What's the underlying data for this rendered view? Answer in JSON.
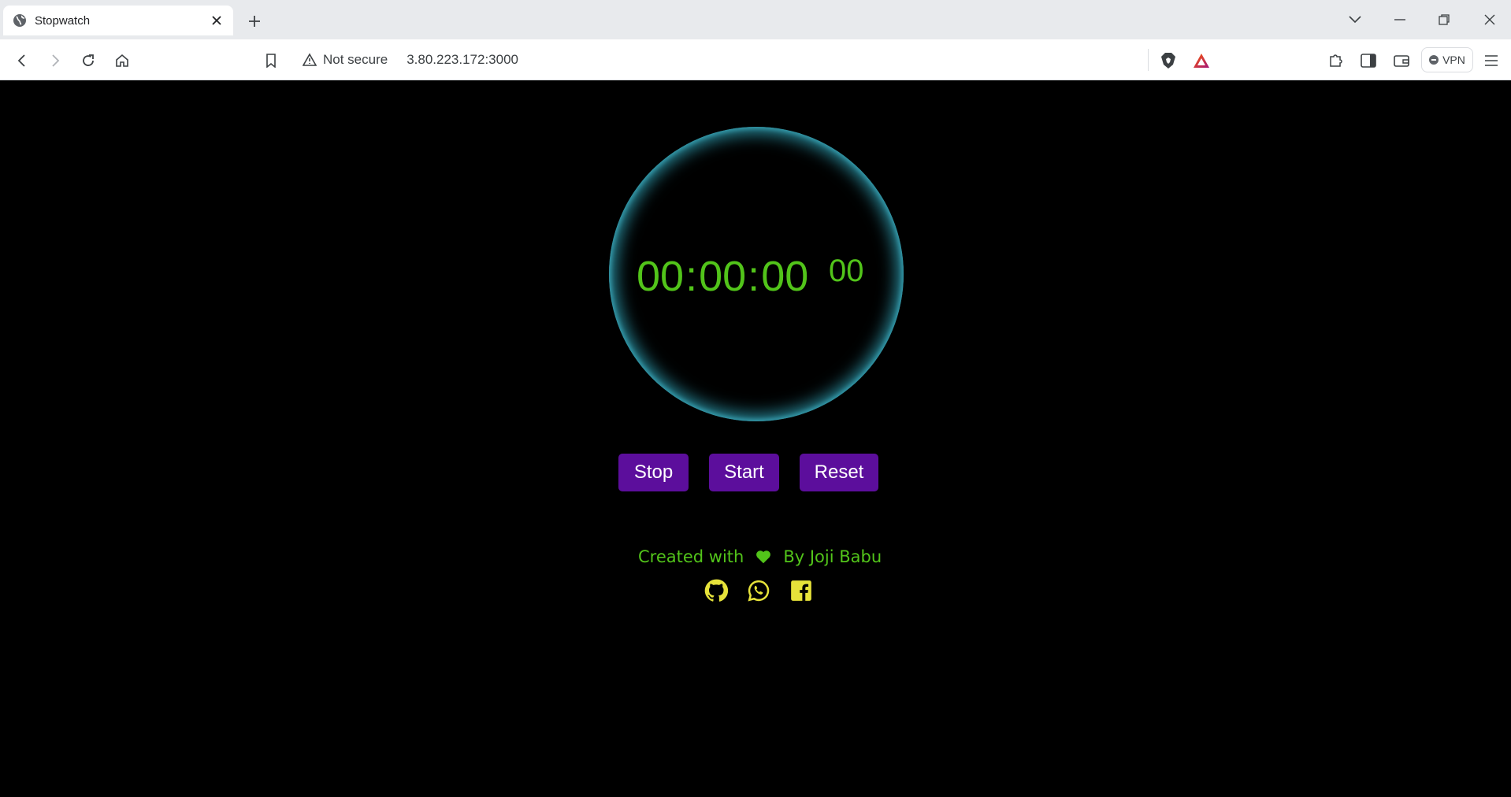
{
  "browser": {
    "tab_title": "Stopwatch",
    "omnibox": {
      "security_label": "Not secure",
      "url": "3.80.223.172:3000"
    },
    "vpn_label": "VPN"
  },
  "stopwatch": {
    "hours": "00",
    "minutes": "00",
    "seconds": "00",
    "milliseconds": "00",
    "separator": ":"
  },
  "controls": {
    "stop_label": "Stop",
    "start_label": "Start",
    "reset_label": "Reset"
  },
  "footer": {
    "created_with": "Created with",
    "author": "By Joji Babu",
    "socials": [
      "github-icon",
      "whatsapp-icon",
      "facebook-icon"
    ]
  },
  "colors": {
    "timer_text": "#52c41a",
    "button_bg": "#5c0e9c",
    "ring_glow": "#2a8fa0",
    "social_icons": "#e6e23a"
  }
}
